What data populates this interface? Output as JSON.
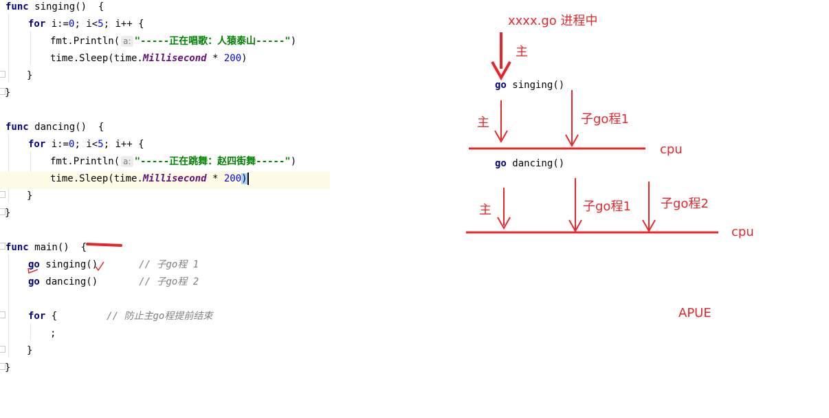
{
  "code": {
    "kw_func": "func",
    "kw_for": "for",
    "kw_go": "go",
    "singing_sig": " singing()  {",
    "dancing_sig": " dancing()  {",
    "main_sig": " main()  {",
    "loop_a": " i:=",
    "loop_n0": "0",
    "loop_b": "; i<",
    "loop_n5": "5",
    "loop_c": "; i++ {",
    "println_call": "fmt.Println(",
    "param_hint": "a:",
    "str_singing": "\"-----正在唱歌：人猿泰山-----\"",
    "str_dancing": "\"-----正在跳舞：赵四街舞-----\"",
    "close_paren": ")",
    "sleep_call": "time.Sleep(time.",
    "millisecond": "Millisecond",
    "times": " * ",
    "num_200": "200",
    "brace_close": "}",
    "call_singing": " singing()",
    "call_dancing": " dancing()",
    "comment_sub1": "// 子go程 1",
    "comment_sub2": "// 子go程 2",
    "for_open": " {",
    "comment_prevent": "// 防止主go程提前结束",
    "semicolon": ";"
  },
  "diagram": {
    "process_label": "xxxx.go 进程中",
    "main_label_top": "主",
    "go_singing_kw": "go",
    "go_singing_fn": " singing()",
    "main_label_1": "主",
    "sub_label_1": "子go程1",
    "cpu_label_1": "cpu",
    "go_dancing_kw": "go",
    "go_dancing_fn": " dancing()",
    "main_label_2": "主",
    "sub_label_2a": "子go程1",
    "sub_label_2b": "子go程2",
    "cpu_label_2": "cpu",
    "apue_label": "APUE"
  },
  "colors": {
    "annotation_red": "#e8262a",
    "keyword_navy": "#000080",
    "string_green": "#008000",
    "field_purple": "#660e7a",
    "number_blue": "#0000ff",
    "comment_gray": "#808080",
    "current_line": "#fdfbe6"
  }
}
